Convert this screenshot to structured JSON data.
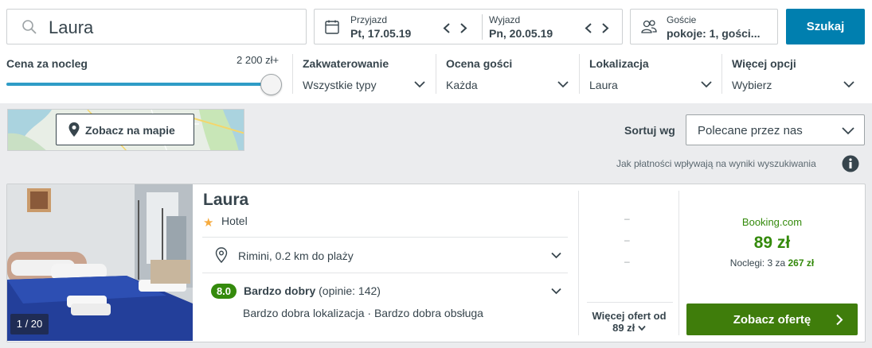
{
  "search": {
    "value": "Laura"
  },
  "dates": {
    "checkin_label": "Przyjazd",
    "checkin_value": "Pt, 17.05.19",
    "checkout_label": "Wyjazd",
    "checkout_value": "Pn, 20.05.19"
  },
  "guests": {
    "label": "Goście",
    "value": "pokoje: 1, gości..."
  },
  "search_button": "Szukaj",
  "filters": {
    "price": {
      "title": "Cena za nocleg",
      "max": "2 200 zł+",
      "level": 1.0
    },
    "accommodation": {
      "title": "Zakwaterowanie",
      "value": "Wszystkie typy"
    },
    "rating": {
      "title": "Ocena gości",
      "value": "Każda"
    },
    "location": {
      "title": "Lokalizacja",
      "value": "Laura"
    },
    "more": {
      "title": "Więcej opcji",
      "value": "Wybierz"
    }
  },
  "map": {
    "button": "Zobacz na mapie"
  },
  "sort": {
    "label": "Sortuj wg",
    "value": "Polecane przez nas"
  },
  "payment_info": "Jak płatności wpływają na wyniki wyszukiwania",
  "hotel": {
    "name": "Laura",
    "type": "Hotel",
    "image_count": "1 / 20",
    "location": "Rimini, 0.2 km do plaży",
    "rating_score": "8.0",
    "rating_label": "Bardzo dobry",
    "rating_reviews": "(opinie: 142)",
    "highlights": "Bardzo dobra lokalizacja · Bardzo dobra obsługa",
    "alt_prices": [
      "–",
      "–",
      "–"
    ],
    "more_offers_line1": "Więcej ofert od",
    "more_offers_line2": "89 zł",
    "provider": "Booking.com",
    "price": "89 zł",
    "nights_prefix": "Noclegi: 3 za",
    "nights_total": "267 zł",
    "deal_button": "Zobacz ofertę"
  },
  "colors": {
    "primary_blue": "#007faf",
    "green": "#348a0c",
    "deal_green": "#3f7d0b",
    "star": "#f6ab3f"
  },
  "icons": [
    "search-icon",
    "calendar-icon",
    "chevron-left-icon",
    "chevron-right-icon",
    "guests-icon",
    "chevron-down-icon",
    "map-pin-icon",
    "info-icon",
    "star-icon",
    "chevron-right-icon"
  ]
}
